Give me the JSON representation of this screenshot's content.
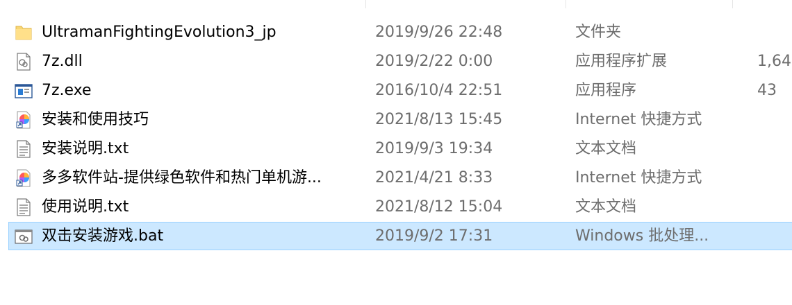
{
  "files": [
    {
      "name": "UltramanFightingEvolution3_jp",
      "date": "2019/9/26 22:48",
      "type": "文件夹",
      "size": "",
      "icon": "folder-icon",
      "selected": false
    },
    {
      "name": "7z.dll",
      "date": "2019/2/22 0:00",
      "type": "应用程序扩展",
      "size": "1,64",
      "icon": "dll-file-icon",
      "selected": false
    },
    {
      "name": "7z.exe",
      "date": "2016/10/4 22:51",
      "type": "应用程序",
      "size": "43",
      "icon": "exe-file-icon",
      "selected": false
    },
    {
      "name": "安装和使用技巧",
      "date": "2021/8/13 15:45",
      "type": "Internet 快捷方式",
      "size": "",
      "icon": "internet-shortcut-icon",
      "selected": false
    },
    {
      "name": "安装说明.txt",
      "date": "2019/9/3 19:34",
      "type": "文本文档",
      "size": "",
      "icon": "text-document-icon",
      "selected": false
    },
    {
      "name": "多多软件站-提供绿色软件和热门单机游...",
      "date": "2021/4/21 8:33",
      "type": "Internet 快捷方式",
      "size": "",
      "icon": "internet-shortcut-icon",
      "selected": false
    },
    {
      "name": "使用说明.txt",
      "date": "2021/8/12 15:04",
      "type": "文本文档",
      "size": "",
      "icon": "text-document-icon",
      "selected": false
    },
    {
      "name": "双击安装游戏.bat",
      "date": "2019/9/2 17:31",
      "type": "Windows 批处理...",
      "size": "",
      "icon": "batch-file-icon",
      "selected": true
    }
  ],
  "colors": {
    "selection_bg": "#cce8ff",
    "selection_border": "#99d1ff",
    "folder": "#f8d775",
    "secondary_text": "#6d6d6d"
  }
}
